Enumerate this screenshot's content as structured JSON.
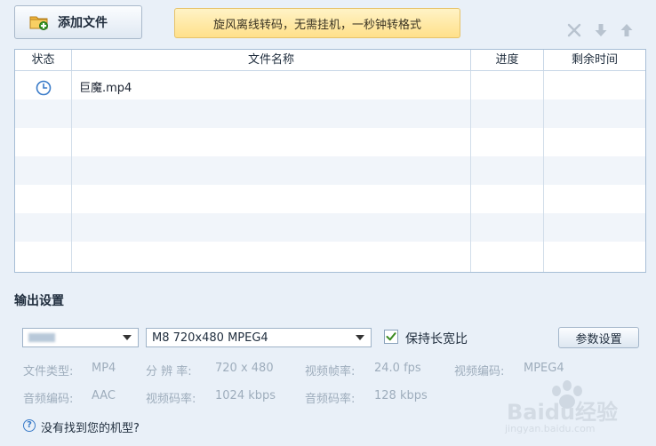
{
  "toolbar": {
    "add_file_label": "添加文件",
    "promo_text": "旋风离线转码，无需挂机，一秒钟转格式",
    "icons": [
      "close-icon",
      "arrow-down-icon",
      "arrow-up-icon"
    ]
  },
  "table": {
    "columns": [
      "状态",
      "文件名称",
      "进度",
      "剩余时间"
    ],
    "rows": [
      {
        "status_icon": "clock-icon",
        "filename": "巨魔.mp4",
        "progress": "",
        "remaining": ""
      }
    ]
  },
  "output": {
    "title": "输出设置",
    "device_select": "",
    "profile_select": "M8 720x480 MPEG4",
    "keep_ratio_label": "保持长宽比",
    "keep_ratio_checked": true,
    "params_button": "参数设置",
    "info": {
      "file_type_label": "文件类型:",
      "file_type_value": "MP4",
      "resolution_label": "分 辨 率:",
      "resolution_value": "720 x 480",
      "framerate_label": "视频帧率:",
      "framerate_value": "24.0 fps",
      "video_codec_label": "视频编码:",
      "video_codec_value": "MPEG4",
      "audio_codec_label": "音频编码:",
      "audio_codec_value": "AAC",
      "video_bitrate_label": "视频码率:",
      "video_bitrate_value": "1024 kbps",
      "audio_bitrate_label": "音频码率:",
      "audio_bitrate_value": "128 kbps"
    },
    "help_link": "没有找到您的机型?"
  },
  "watermark": {
    "brand": "Baidu经验",
    "url": "jingyan.baidu.com"
  },
  "colors": {
    "background": "#e9f0f8",
    "promo_bg": "#ffe08a",
    "accent_blue": "#3a7bc8",
    "check_green": "#3a8a1f"
  }
}
